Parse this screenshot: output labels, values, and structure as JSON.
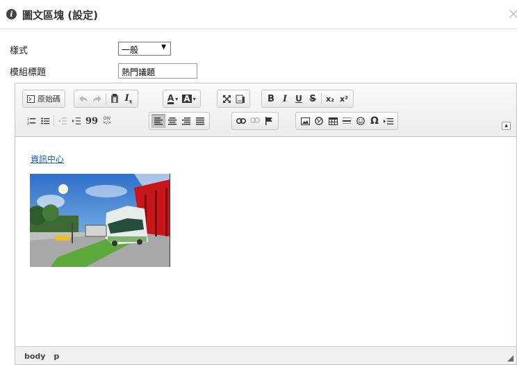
{
  "dialog": {
    "title": "圖文區塊 (設定)",
    "close_label": "×"
  },
  "form": {
    "style_label": "樣式",
    "style_value": "一般",
    "module_title_label": "模組標題",
    "module_title_value": "熱門議題"
  },
  "toolbar": {
    "source_label": "原始碼",
    "bold": "B",
    "italic": "I",
    "underline": "U",
    "strike": "S",
    "subscript": "x₂",
    "superscript": "x²",
    "quote": "99",
    "font_color": "A",
    "bg_color": "A",
    "omega": "Ω",
    "div_top": "DIV",
    "div_bottom": "</>",
    "remove_format": "Tx"
  },
  "content": {
    "link_text": "資訊中心",
    "photo_desc": "light-rail-tram-photo"
  },
  "statusbar": {
    "path": [
      "body",
      "p"
    ]
  },
  "colors": {
    "link": "#0e5db5",
    "toolbar_bg": "#ececec"
  }
}
